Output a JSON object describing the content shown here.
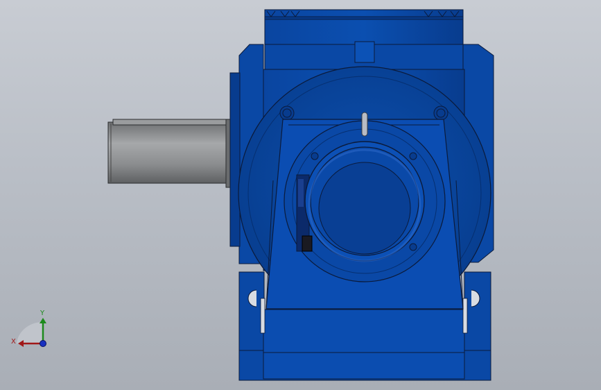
{
  "viewport": {
    "background_top": "#c8ccd3",
    "background_bottom": "#a9aeb6"
  },
  "model": {
    "body_color": "#0a4aa3",
    "body_dark": "#063680",
    "body_light": "#2c6fcf",
    "shaft_color": "#8c8e90",
    "outline_color": "#0b1a3a"
  },
  "triad": {
    "x_label": "X",
    "y_label": "Y",
    "x_color": "#a01818",
    "y_color": "#1c8a1c",
    "z_color": "#1830c0"
  }
}
